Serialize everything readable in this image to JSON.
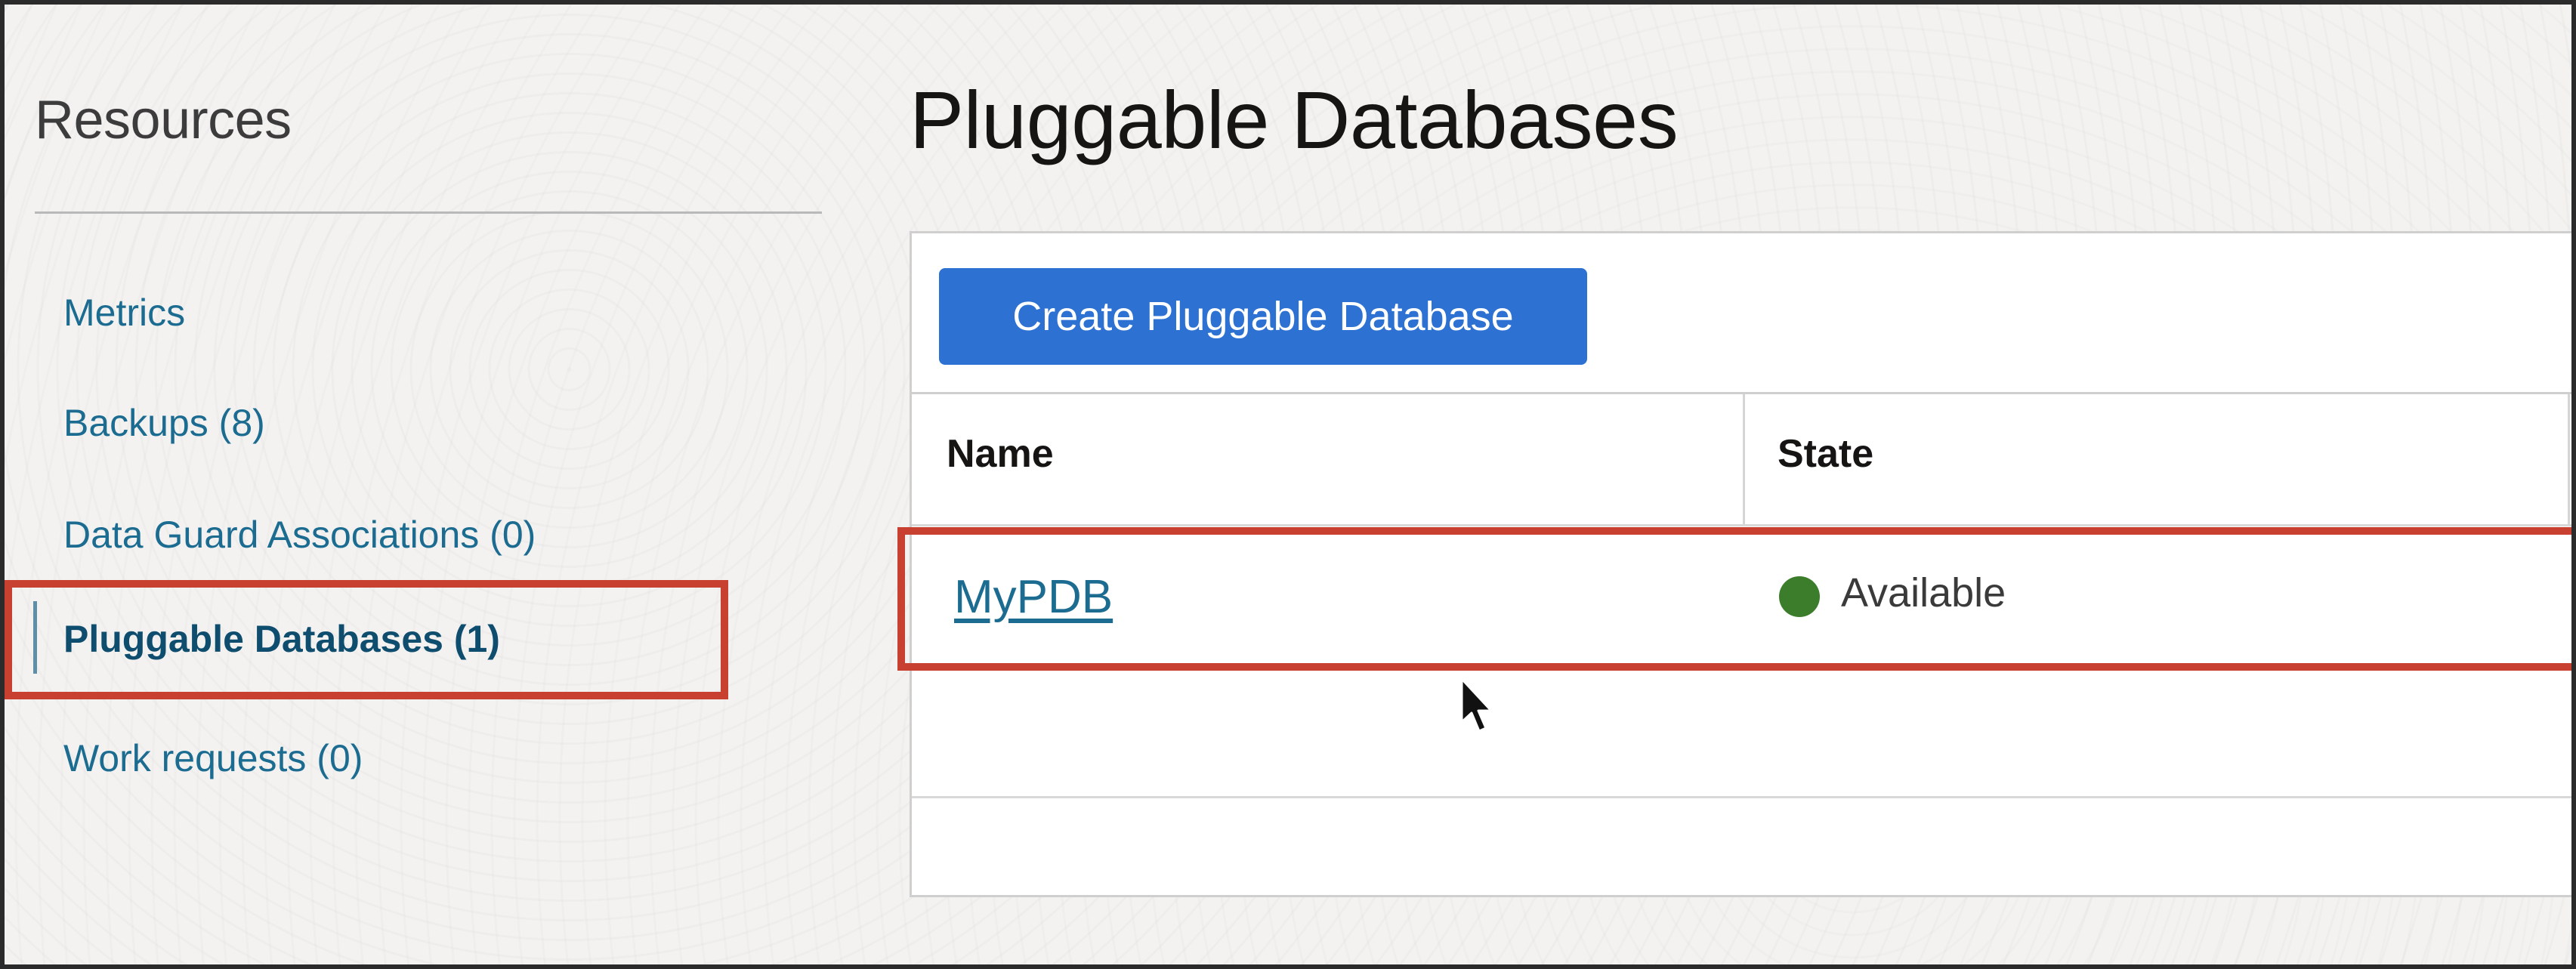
{
  "sidebar": {
    "title": "Resources",
    "items": [
      {
        "label": "Metrics"
      },
      {
        "label": "Backups (8)"
      },
      {
        "label": "Data Guard Associations (0)"
      },
      {
        "label": "Pluggable Databases (1)"
      },
      {
        "label": "Work requests (0)"
      }
    ]
  },
  "main": {
    "title": "Pluggable Databases",
    "create_button": "Create Pluggable Database",
    "table": {
      "columns": [
        "Name",
        "State"
      ],
      "rows": [
        {
          "name": "MyPDB",
          "state": "Available"
        }
      ]
    }
  },
  "colors": {
    "accent": "#2d71d2",
    "link": "#1c6c91",
    "highlight_box": "#c8402f",
    "status_available": "#3b7d2a"
  },
  "icons": {
    "status": "status-dot-icon",
    "cursor": "mouse-cursor-icon"
  }
}
